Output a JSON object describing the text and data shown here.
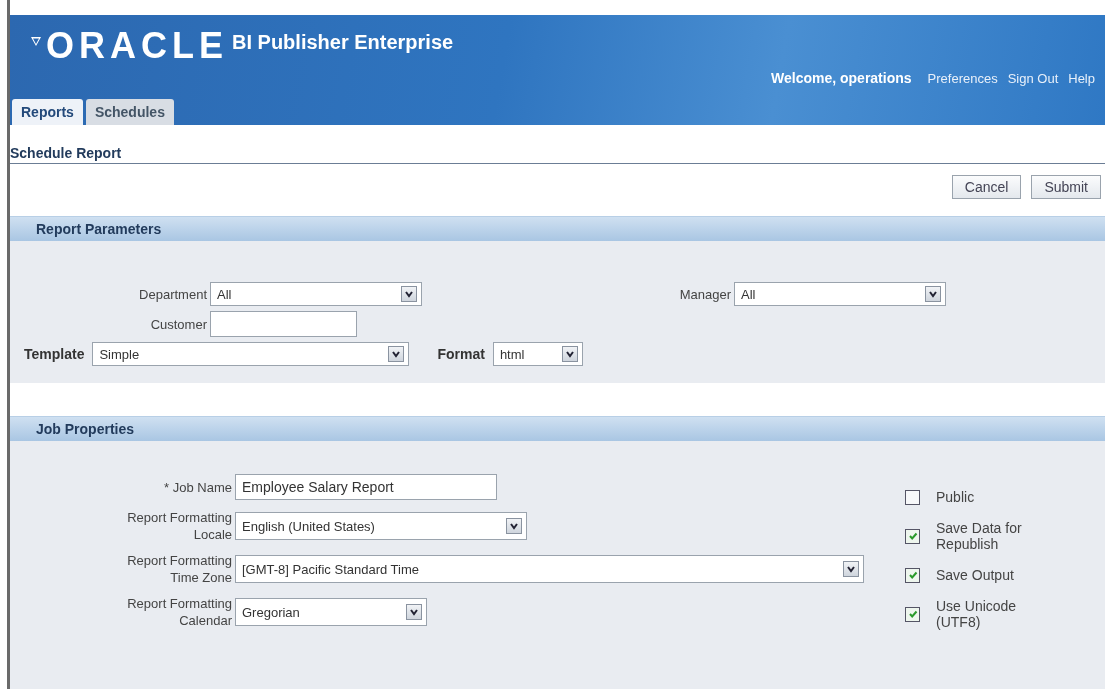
{
  "header": {
    "brand": "ORACLE",
    "product": "BI Publisher Enterprise",
    "welcome": "Welcome, operations",
    "links": [
      "Preferences",
      "Sign Out",
      "Help"
    ]
  },
  "tabs": [
    {
      "label": "Reports",
      "selected": true
    },
    {
      "label": "Schedules",
      "selected": false
    }
  ],
  "page_title": "Schedule Report",
  "buttons": [
    "Cancel",
    "Submit"
  ],
  "report_parameters": {
    "title": "Report Parameters",
    "department": {
      "label": "Department",
      "value": "All"
    },
    "manager": {
      "label": "Manager",
      "value": "All"
    },
    "customer": {
      "label": "Customer"
    },
    "template": {
      "label": "Template",
      "value": "Simple"
    },
    "format": {
      "label": "Format",
      "value": "html"
    }
  },
  "job_properties": {
    "title": "Job Properties",
    "job_name": {
      "label": "* Job Name",
      "value": "Employee Salary Report"
    },
    "locale": {
      "label": [
        "Report Formatting",
        "Locale"
      ],
      "value": "English (United States)"
    },
    "time_zone": {
      "label": [
        "Report Formatting",
        "Time Zone"
      ],
      "value": "[GMT-8] Pacific Standard Time"
    },
    "calendar": {
      "label": [
        "Report Formatting",
        "Calendar"
      ],
      "value": "Gregorian"
    },
    "options": [
      {
        "label": [
          "Public"
        ],
        "checked": false
      },
      {
        "label": [
          "Save Data for",
          "Republish"
        ],
        "checked": true
      },
      {
        "label": [
          "Save Output"
        ],
        "checked": true
      },
      {
        "label": [
          "Use Unicode",
          "(UTF8)"
        ],
        "checked": true
      }
    ]
  }
}
